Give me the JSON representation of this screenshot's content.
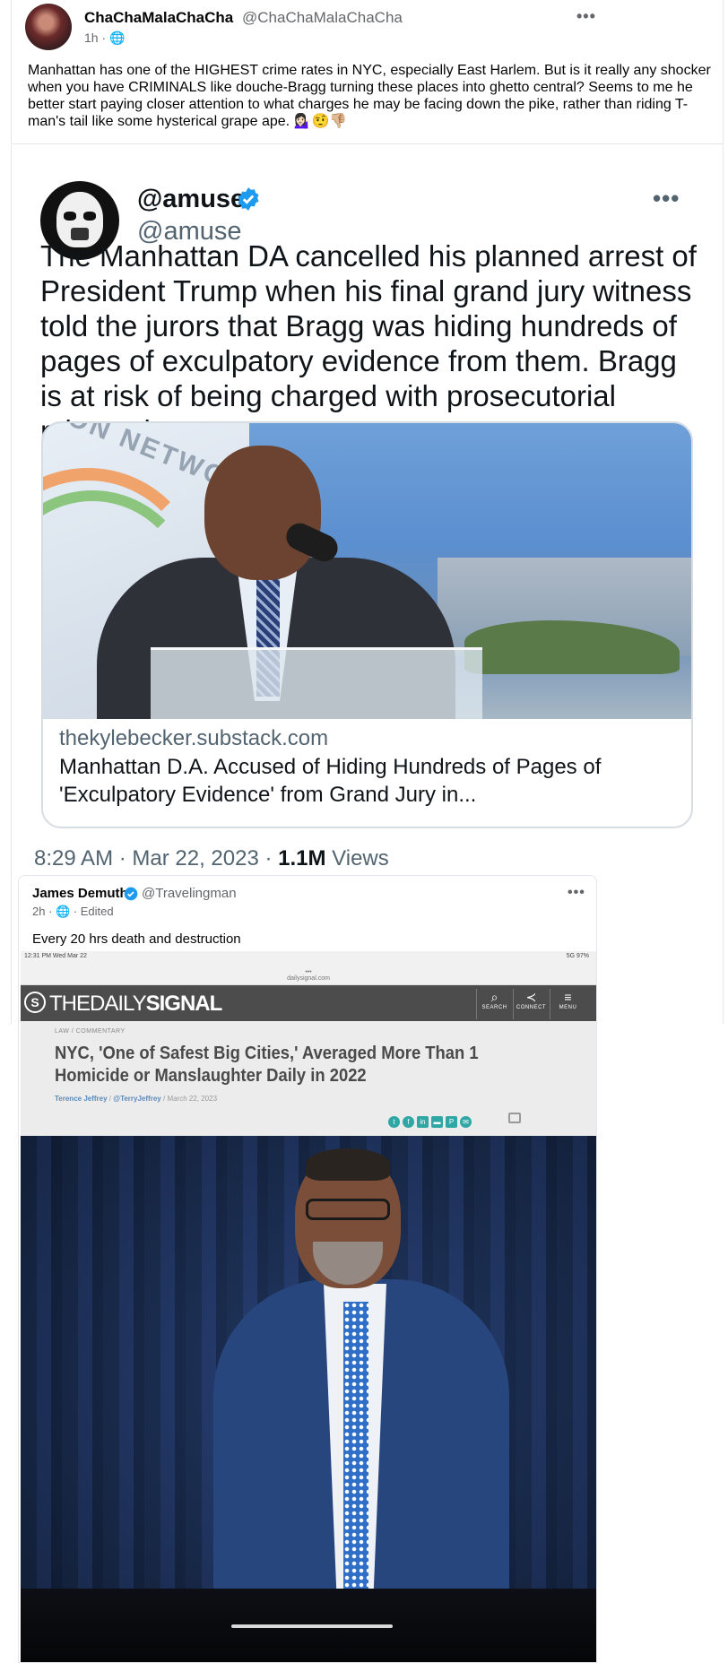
{
  "post1": {
    "author": "ChaChaMalaChaCha",
    "handle": "@ChaChaMalaChaCha",
    "meta": "1h · ",
    "more": "•••",
    "text": "Manhattan has one of the HIGHEST crime rates in NYC, especially East Harlem. But is it really any shocker when you have CRIMINALS like douche-Bragg turning these places into ghetto central? Seems to me he better start paying closer attention to what charges he may be facing down the pike, rather than riding T-man's tail like some hysterical grape ape. 💁🏻‍♀️🤨👎🏼"
  },
  "tweet": {
    "name": "@amuse",
    "handle": "@amuse",
    "more": "•••",
    "text": "The Manhattan DA cancelled his planned arrest of President Trump when his final grand jury witness told the jurors that Bragg was hiding hundreds of pages of exculpatory evidence from them. Bragg is at risk of being charged with prosecutorial misconduct.",
    "card": {
      "image_text": "ON NETWORK",
      "domain": "thekylebecker.substack.com",
      "title": "Manhattan D.A. Accused of Hiding Hundreds of Pages of 'Exculpatory Evidence' from Grand Jury in..."
    },
    "time": "8:29 AM · Mar 22, 2023 · ",
    "views_count": "1.1M",
    "views_label": " Views"
  },
  "post2": {
    "author": "James Demuth",
    "handle": "@Travelingman",
    "meta": "2h · 🌐 · Edited",
    "more": "•••",
    "text": "Every 20 hrs death and destruction",
    "photo": {
      "ios_time": "12:31 PM  Wed Mar 22",
      "ios_dots": "•••",
      "ios_url": "dailysignal.com",
      "ios_status": "5G 97%",
      "site_logo_prefix": "THEDAILY",
      "site_logo_bold": "SIGNAL",
      "site_logo_mark": "S",
      "nav": [
        {
          "icon": "⌕",
          "label": "SEARCH"
        },
        {
          "icon": "≺",
          "label": "CONNECT"
        },
        {
          "icon": "≡",
          "label": "MENU"
        }
      ],
      "category": "LAW / COMMENTARY",
      "headline": "NYC, 'One of Safest Big Cities,' Averaged More Than 1 Homicide or Manslaughter Daily in 2022",
      "byline_author": "Terence Jeffrey",
      "byline_handle": "@TerryJeffrey",
      "byline_date": "March 22, 2023",
      "byline_sep": "/"
    }
  },
  "colors": {
    "verified": "#1d9bf0",
    "tweet_text": "#0f1419",
    "muted": "#536471",
    "fb_muted": "#65676b",
    "share_teal": "#2fa7a5"
  }
}
